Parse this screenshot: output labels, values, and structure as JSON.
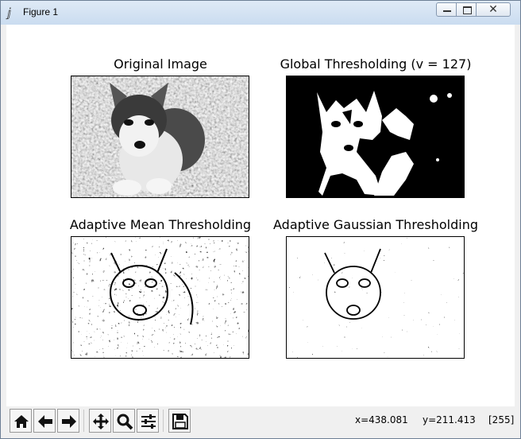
{
  "window": {
    "title": "Figure 1",
    "title_icon": "feather-icon"
  },
  "subplots": [
    {
      "title": "Original Image"
    },
    {
      "title": "Global Thresholding (v = 127)"
    },
    {
      "title": "Adaptive Mean Thresholding"
    },
    {
      "title": "Adaptive Gaussian Thresholding"
    }
  ],
  "toolbar": {
    "buttons": [
      "home-icon",
      "back-arrow-icon",
      "forward-arrow-icon",
      "pan-icon",
      "zoom-icon",
      "subplots-config-icon",
      "save-icon"
    ]
  },
  "status": {
    "x": "x=438.081",
    "y": "y=211.413",
    "value": "[255]"
  }
}
